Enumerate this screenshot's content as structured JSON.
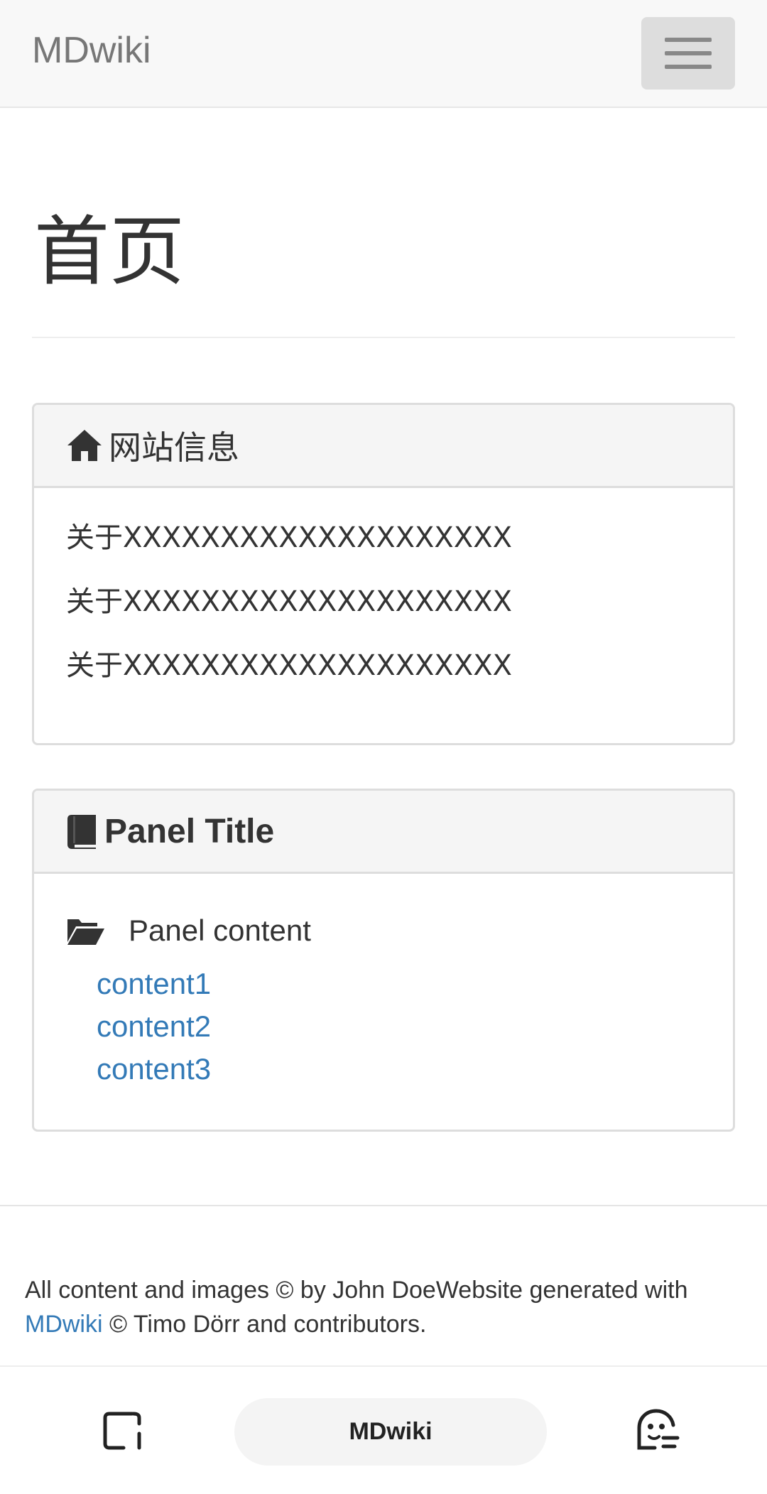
{
  "navbar": {
    "brand": "MDwiki",
    "menu_icon": "hamburger-menu-icon"
  },
  "page": {
    "title": "首页"
  },
  "panel_info": {
    "icon": "home-icon",
    "heading": "网站信息",
    "lines": [
      "关于XXXXXXXXXXXXXXXXXXXX",
      "关于XXXXXXXXXXXXXXXXXXXX",
      "关于XXXXXXXXXXXXXXXXXXXX"
    ]
  },
  "panel_content": {
    "icon": "book-icon",
    "heading": "Panel Title",
    "folder_icon": "folder-open-icon",
    "content_label": "Panel content",
    "links": [
      "content1",
      "content2",
      "content3"
    ]
  },
  "footer": {
    "text_before": "All content and images © by John DoeWebsite generated with",
    "link": "MDwiki",
    "text_after": " © Timo Dörr and contributors."
  },
  "bottom_bar": {
    "tabs_icon": "tabs-icon",
    "pill_label": "MDwiki",
    "assistant_icon": "assistant-face-icon"
  },
  "colors": {
    "link": "#337ab7",
    "navbar_bg": "#f8f8f8",
    "panel_heading_bg": "#f5f5f5"
  }
}
